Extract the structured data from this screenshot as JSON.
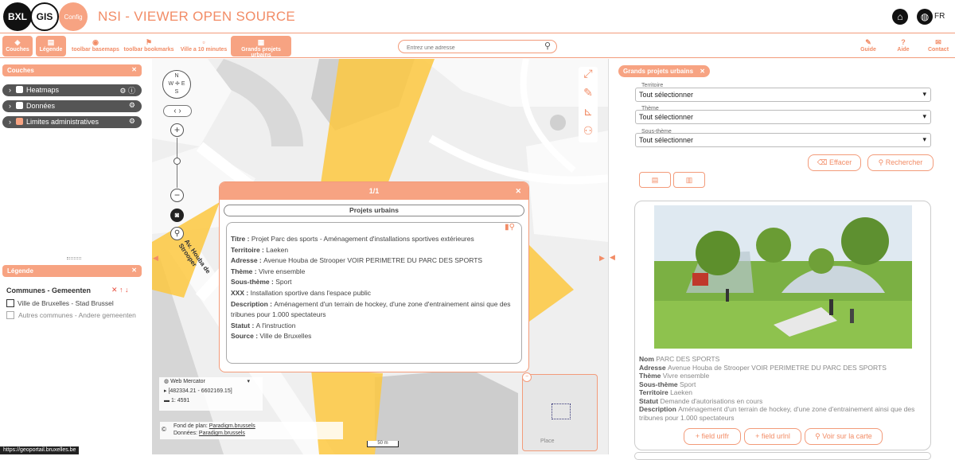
{
  "header": {
    "logo_bxl": "BXL",
    "logo_gis": "GIS",
    "logo_config": "Config",
    "title": "NSI - VIEWER OPEN SOURCE",
    "lang": "FR"
  },
  "toolbar": {
    "items": [
      "Couches",
      "Légende",
      "toolbar basemaps",
      "toolbar bookmarks",
      "Ville a 10 minutes",
      "Grands projets urbains"
    ],
    "right": [
      "Guide",
      "Aide",
      "Contact"
    ]
  },
  "search": {
    "placeholder": "Entrez une adresse"
  },
  "layers_panel": {
    "title": "Couches",
    "items": [
      "Heatmaps",
      "Données",
      "Limites administratives"
    ]
  },
  "legend_panel": {
    "title": "Légende",
    "group": "Communes - Gemeenten",
    "items": [
      "Ville de Bruxelles - Stad Brussel",
      "Autres communes - Andere gemeenten"
    ]
  },
  "map": {
    "street": "Av. Houba de Strooper",
    "projection": "Web Mercator",
    "coords": "[482334.21 - 6602169.15]",
    "scale": "1: 4591",
    "basemap": "Fond de plan:",
    "basemap_link": "Paradigm.brussels",
    "data": "Données:",
    "data_link": "Paradigm.brussels",
    "scale_bar": "50 m",
    "overview_label": "Place"
  },
  "popup": {
    "pager": "1/1",
    "layer_button": "Projets urbains",
    "fields": [
      {
        "k": "Titre",
        "v": "Projet Parc des sports - Aménagement d'installations sportives extérieures"
      },
      {
        "k": "Territoire",
        "v": "Laeken"
      },
      {
        "k": "Adresse",
        "v": "Avenue Houba de Strooper VOIR PERIMETRE DU PARC DES SPORTS"
      },
      {
        "k": "Thème",
        "v": "Vivre ensemble"
      },
      {
        "k": "Sous-thème",
        "v": "Sport"
      },
      {
        "k": "XXX",
        "v": "Installation sportive dans l'espace public"
      },
      {
        "k": "Description",
        "v": "Aménagement d'un terrain de hockey, d'une zone d'entrainement ainsi que des tribunes pour 1.000 spectateurs"
      },
      {
        "k": "Statut",
        "v": "A l'instruction"
      },
      {
        "k": "Source",
        "v": "Ville de Bruxelles"
      }
    ]
  },
  "right_panel": {
    "title": "Grands projets urbains",
    "filters": [
      {
        "label": "Territoire",
        "value": "Tout sélectionner"
      },
      {
        "label": "Thème",
        "value": "Tout sélectionner"
      },
      {
        "label": "Sous-thème",
        "value": "Tout sélectionner"
      }
    ],
    "clear": "Effacer",
    "search": "Rechercher",
    "result": {
      "fields": [
        {
          "k": "Nom",
          "v": "PARC DES SPORTS"
        },
        {
          "k": "Adresse",
          "v": "Avenue Houba de Strooper VOIR PERIMETRE DU PARC DES SPORTS"
        },
        {
          "k": "Thème",
          "v": "Vivre ensemble"
        },
        {
          "k": "Sous-thème",
          "v": "Sport"
        },
        {
          "k": "Territoire",
          "v": "Laeken"
        },
        {
          "k": "Statut",
          "v": "Demande d'autorisations en cours"
        },
        {
          "k": "Description",
          "v": "Aménagement d'un terrain de hockey, d'une zone d'entrainement ainsi que des tribunes pour 1.000 spectateurs"
        }
      ],
      "buttons": [
        "field urlfr",
        "field urlnl",
        "Voir sur la carte"
      ]
    }
  },
  "statusbar": "https://geoportail.bruxelles.be",
  "colors": {
    "accent": "#f7a382",
    "accent_text": "#f28c66",
    "polygon": "#fdc840"
  }
}
